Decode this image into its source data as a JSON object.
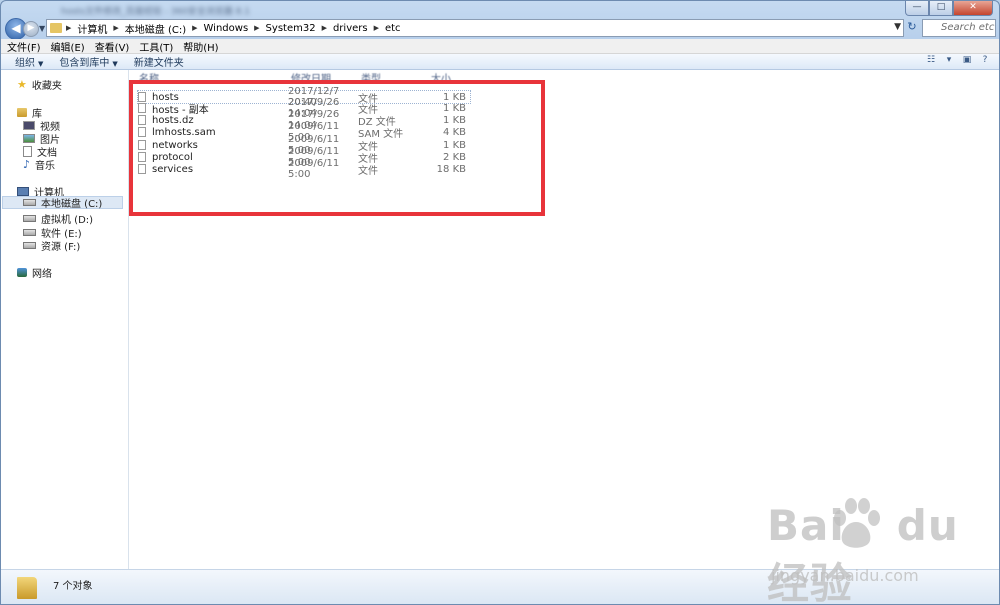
{
  "window": {
    "title_blurred": "hosts文件修改_百度经验 - 360安全浏览器 8.1",
    "caption": {
      "minimize": "—",
      "maximize": "□",
      "close": "✕"
    }
  },
  "address": {
    "breadcrumbs": [
      "计算机",
      "本地磁盘 (C:)",
      "Windows",
      "System32",
      "drivers",
      "etc"
    ],
    "search_placeholder": "Search etc"
  },
  "menu": [
    "文件(F)",
    "编辑(E)",
    "查看(V)",
    "工具(T)",
    "帮助(H)"
  ],
  "commands": {
    "organize": "组织",
    "include": "包含到库中",
    "new_folder": "新建文件夹"
  },
  "nav": {
    "favorites": "收藏夹",
    "library": "库",
    "library_items": [
      "视频",
      "图片",
      "文档",
      "音乐"
    ],
    "computer": "计算机",
    "drives": [
      "本地磁盘 (C:)",
      "虚拟机 (D:)",
      "软件 (E:)",
      "资源 (F:)"
    ],
    "network": "网络"
  },
  "columns": {
    "name": "名称",
    "date": "修改日期",
    "type": "类型",
    "size": "大小"
  },
  "files": [
    {
      "name": "hosts",
      "date": "2017/12/7 20:40",
      "type": "文件",
      "size": "1 KB"
    },
    {
      "name": "hosts - 副本",
      "date": "2017/9/26 14:04",
      "type": "文件",
      "size": "1 KB"
    },
    {
      "name": "hosts.dz",
      "date": "2017/9/26 14:04",
      "type": "DZ 文件",
      "size": "1 KB"
    },
    {
      "name": "lmhosts.sam",
      "date": "2009/6/11 5:00",
      "type": "SAM 文件",
      "size": "4 KB"
    },
    {
      "name": "networks",
      "date": "2009/6/11 5:00",
      "type": "文件",
      "size": "1 KB"
    },
    {
      "name": "protocol",
      "date": "2009/6/11 5:00",
      "type": "文件",
      "size": "2 KB"
    },
    {
      "name": "services",
      "date": "2009/6/11 5:00",
      "type": "文件",
      "size": "18 KB"
    }
  ],
  "status": {
    "count_text": "7 个对象"
  },
  "watermark": {
    "brand": "Bai",
    "suffix": "du 经验",
    "url": "jingyan.baidu.com"
  }
}
